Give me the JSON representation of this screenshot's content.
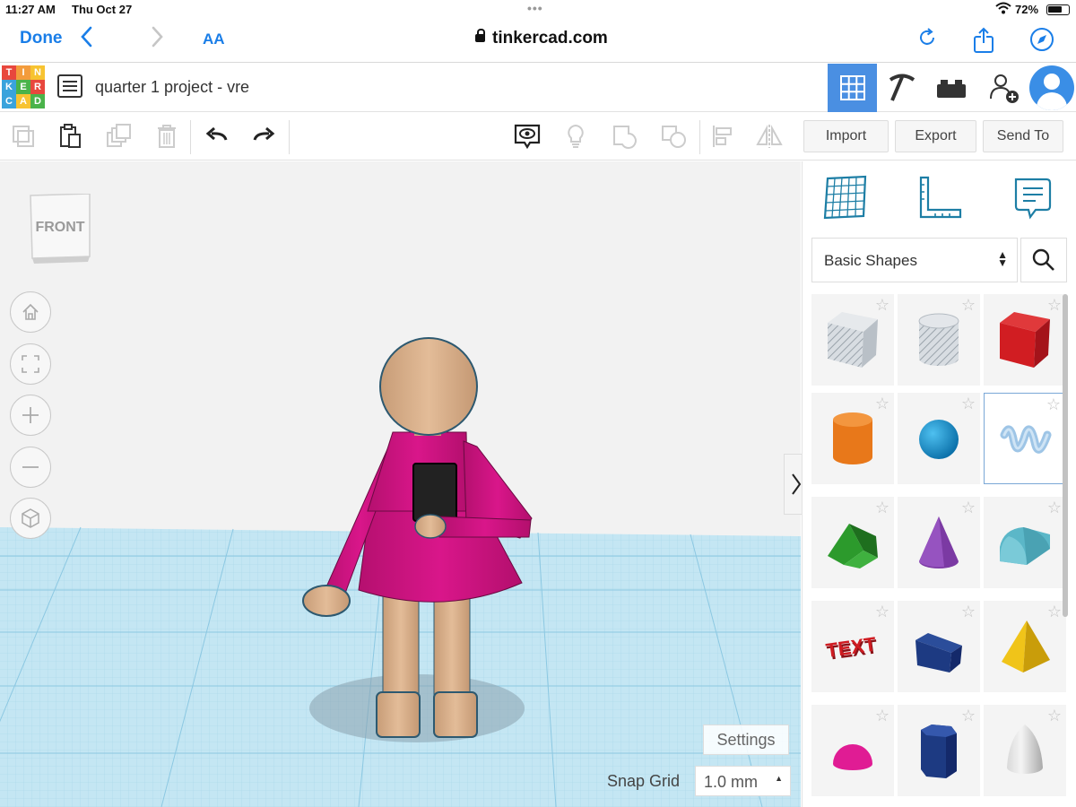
{
  "status_bar": {
    "time": "11:27 AM",
    "date": "Thu Oct 27",
    "battery": "72%"
  },
  "browser": {
    "done_label": "Done",
    "text_size_label": "AA",
    "url": "tinkercad.com"
  },
  "app": {
    "logo_letters": [
      "T",
      "I",
      "N",
      "K",
      "E",
      "R",
      "C",
      "A",
      "D"
    ],
    "project_title": "quarter 1 project - vre"
  },
  "toolbar": {
    "import_label": "Import",
    "export_label": "Export",
    "send_to_label": "Send To"
  },
  "workplane": {
    "viewcube_face": "FRONT",
    "settings_label": "Settings",
    "snap_grid_label": "Snap Grid",
    "snap_grid_value": "1.0 mm"
  },
  "shapes_panel": {
    "category": "Basic Shapes",
    "shapes": [
      {
        "name": "box-hole-icon"
      },
      {
        "name": "cylinder-hole-icon"
      },
      {
        "name": "box-icon"
      },
      {
        "name": "cylinder-icon"
      },
      {
        "name": "sphere-icon"
      },
      {
        "name": "scribble-icon"
      },
      {
        "name": "roof-icon"
      },
      {
        "name": "cone-icon"
      },
      {
        "name": "round-roof-icon"
      },
      {
        "name": "text-icon"
      },
      {
        "name": "wedge-icon"
      },
      {
        "name": "pyramid-icon"
      },
      {
        "name": "half-sphere-icon"
      },
      {
        "name": "polygon-icon"
      },
      {
        "name": "paraboloid-icon"
      }
    ]
  },
  "colors": {
    "accent": "#1a7ee8",
    "selected_tab": "#4a8fe2",
    "figure_skin": "#d9b18d",
    "figure_dress": "#cc1280",
    "grid_plane": "#bfe3f1"
  }
}
